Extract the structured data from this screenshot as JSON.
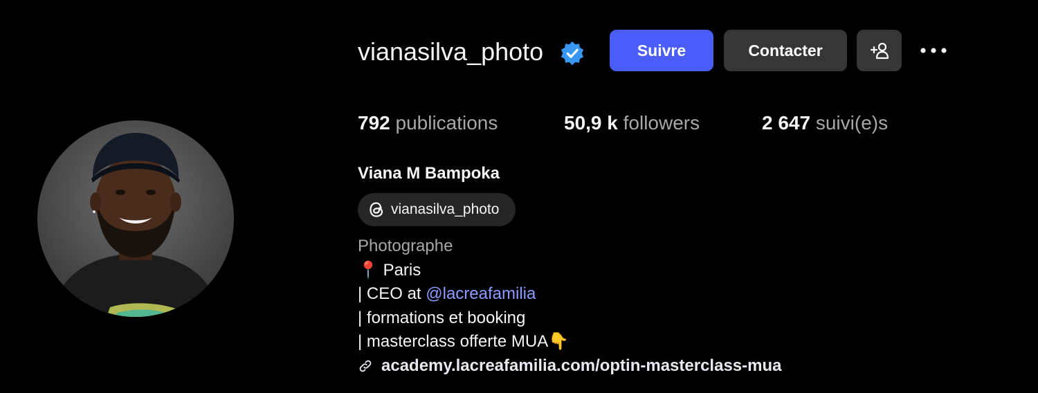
{
  "profile": {
    "username": "vianasilva_photo",
    "verified_icon": "verified-badge-icon",
    "full_name": "Viana M Bampoka",
    "avatar_icon": "profile-photo"
  },
  "actions": {
    "follow_label": "Suivre",
    "contact_label": "Contacter",
    "add_user_icon": "add-person-icon",
    "more_icon": "more-horizontal-icon"
  },
  "stats": [
    {
      "value": "792",
      "label": "publications"
    },
    {
      "value": "50,9 k",
      "label": "followers"
    },
    {
      "value": "2 647",
      "label": "suivi(e)s"
    }
  ],
  "threads": {
    "icon": "threads-icon",
    "handle": "vianasilva_photo"
  },
  "bio": {
    "category": "Photographe",
    "location_emoji": "📍",
    "location": "Paris",
    "ceo_prefix": "| CEO at ",
    "mention": "@lacreafamilia",
    "line_formations": "| formations et booking",
    "line_masterclass": "| masterclass offerte MUA",
    "masterclass_emoji": "👇",
    "link_icon": "link-icon",
    "link": "academy.lacreafamilia.com/optin-masterclass-mua"
  },
  "colors": {
    "background": "#000000",
    "follow_button": "#4a5df9",
    "secondary_button": "#363636",
    "mention": "#8b9bff",
    "verified": "#3897f0",
    "muted_text": "#a8a8a8"
  }
}
